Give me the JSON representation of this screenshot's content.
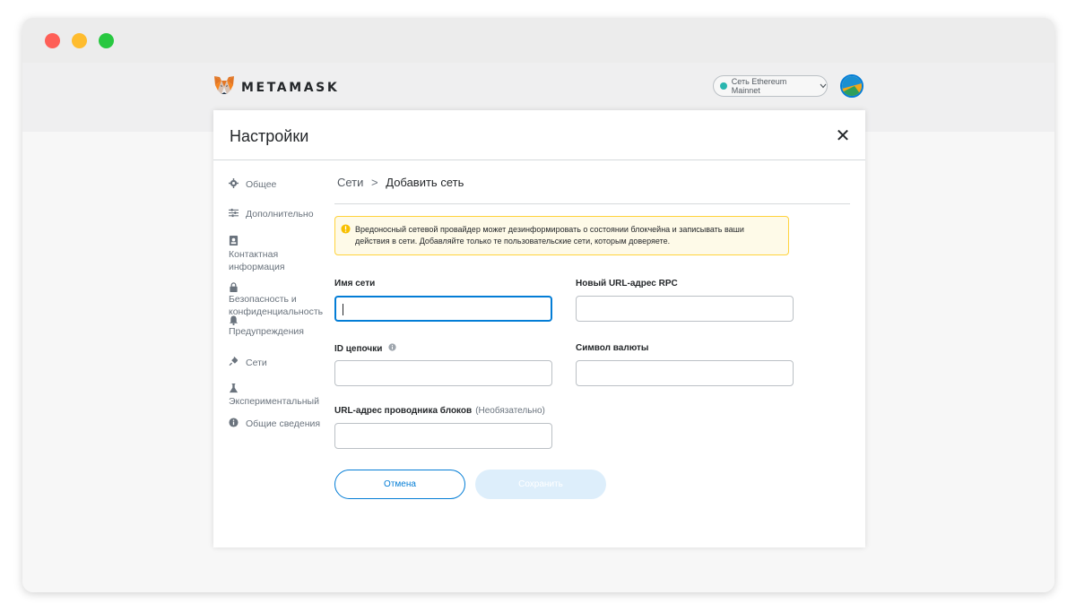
{
  "brand": {
    "name": "METAMASK"
  },
  "network": {
    "label": "Сеть Ethereum Mainnet",
    "dot_color": "#29b6af"
  },
  "settings": {
    "title": "Настройки",
    "close_icon": "close-icon"
  },
  "sidebar": {
    "items": [
      {
        "label": "Общее",
        "icon": "gear-icon"
      },
      {
        "label": "Дополнительно",
        "icon": "sliders-icon"
      },
      {
        "label": "Контактная информация",
        "icon": "contact-book-icon"
      },
      {
        "label": "Безопасность и конфиденциальность",
        "icon": "lock-icon"
      },
      {
        "label": "Предупреждения",
        "icon": "bell-icon"
      },
      {
        "label": "Сети",
        "icon": "plug-icon"
      },
      {
        "label": "Экспериментальный",
        "icon": "flask-icon"
      },
      {
        "label": "Общие сведения",
        "icon": "info-icon"
      }
    ]
  },
  "breadcrumb": {
    "root": "Сети",
    "separator": ">",
    "current": "Добавить сеть"
  },
  "warning": {
    "text": "Вредоносный сетевой провайдер может дезинформировать о состоянии блокчейна и записывать ваши действия в сети. Добавляйте только те пользовательские сети, которым доверяете.",
    "border_color": "#ffd33d",
    "bg_color": "#fefae8"
  },
  "form": {
    "network_name": {
      "label": "Имя сети",
      "value": ""
    },
    "rpc_url": {
      "label": "Новый URL-адрес RPC",
      "value": ""
    },
    "chain_id": {
      "label": "ID цепочки",
      "value": ""
    },
    "currency_symbol": {
      "label": "Символ валюты",
      "value": ""
    },
    "explorer_url": {
      "label": "URL-адрес проводника блоков",
      "optional": "(Необязательно)",
      "value": ""
    }
  },
  "buttons": {
    "cancel": "Отмена",
    "save": "Сохранить"
  },
  "colors": {
    "accent": "#037dd6",
    "text": "#24272a"
  }
}
